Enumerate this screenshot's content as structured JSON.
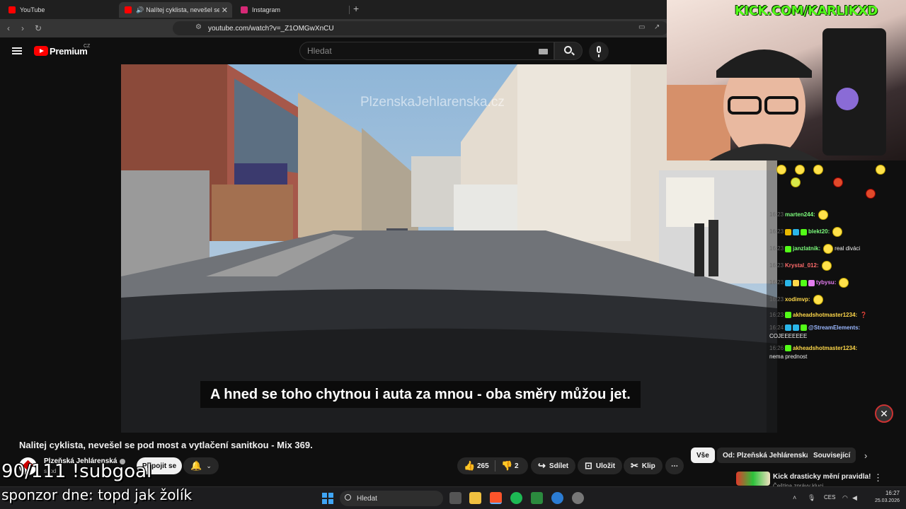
{
  "browser": {
    "tabs": [
      {
        "title": "YouTube",
        "favicon_color": "#ff0000"
      },
      {
        "title": "Nalítej cyklista, nevešel se po",
        "favicon_color": "#ff0000",
        "active": true
      },
      {
        "title": "Instagram",
        "favicon_color": "#d62976"
      }
    ],
    "new_tab_icon": "plus-icon",
    "address": "youtube.com/watch?v=_Z1OMGwXnCU"
  },
  "youtube": {
    "logo_label": "Premium",
    "region": "CZ",
    "search_placeholder": "Hledat",
    "video": {
      "watermark": "PlzenskaJehlarenska.cz",
      "subtitle": "A hned se toho chytnou i auta za mnou - oba směry můžou jet.",
      "title": "Nalitej cyklista, nevešel se pod most a vytlačení sanitkou - Mix 369."
    },
    "channel": {
      "name": "Plzeňská Jehlárenská",
      "subs": "s. od",
      "subscribe_label": "Připojit se"
    },
    "actions": {
      "likes": "265",
      "dislikes": "2",
      "share": "Sdílet",
      "save": "Uložit",
      "clip": "Klip",
      "more": "⋯"
    },
    "chips": [
      "Vše",
      "Od: Plzeňská Jehlárenská",
      "Související"
    ],
    "recommendation": {
      "title": "Kick drasticky mění pravidla!",
      "sub": "Čeština  zprávy  kluci"
    }
  },
  "stream": {
    "kick_url": "KICK.COM/KARLIKXD",
    "subgoal": "90/111 !subgoal",
    "sponsor": "sponzor dne: topd jak žolík"
  },
  "chat": {
    "messages": [
      {
        "time": "16:23",
        "user": "marten244:",
        "color": "#7cfc7c",
        "text": ""
      },
      {
        "time": "16:23",
        "user": "blekt20:",
        "color": "#7cfc7c",
        "text": ""
      },
      {
        "time": "16:23",
        "user": "janzlatnik:",
        "color": "#7cfc7c",
        "text": "real diváci"
      },
      {
        "time": "16:23",
        "user": "Krystal_012:",
        "color": "#ff6b6b",
        "text": ""
      },
      {
        "time": "16:23",
        "user": "tybysu:",
        "color": "#e47cf0",
        "text": ""
      },
      {
        "time": "16:23",
        "user": "xodimvp:",
        "color": "#ffd84a",
        "text": ""
      },
      {
        "time": "16:23",
        "user": "akheadshotmaster1234:",
        "color": "#ffd84a",
        "text": "❓"
      },
      {
        "time": "16:24",
        "user": "@StreamElements:",
        "color": "#9bb8ff",
        "text": "COJEEEEEEE"
      },
      {
        "time": "16:26",
        "user": "akheadshotmaster1234:",
        "color": "#ffd84a",
        "text": "nema prednost"
      }
    ],
    "close_icon": "close-icon"
  },
  "taskbar": {
    "search_placeholder": "Hledat",
    "lang": "CES",
    "time": "16:27",
    "date": "25.03.2026"
  }
}
